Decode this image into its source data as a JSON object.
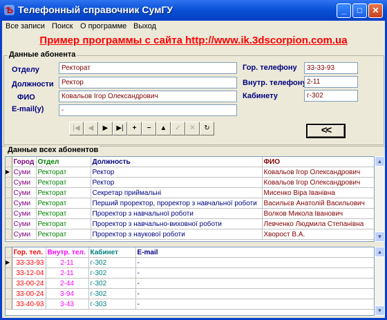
{
  "window": {
    "title": "Телефонный справочник СумГУ",
    "icon": "book-icon"
  },
  "title_buttons": {
    "minimize": "_",
    "maximize": "□",
    "close": "✕"
  },
  "menu": [
    "Все записи",
    "Поиск",
    "О программе",
    "Выход"
  ],
  "promo": "Пример программы с сайта http://www.ik.3dscorpion.com.ua",
  "subscriber": {
    "caption": "Данные абонента",
    "labels": {
      "dept": "Отделу",
      "position": "Должности",
      "fio": "ФИО",
      "email": "E-mail(y)",
      "city_phone": "Гор. телефону",
      "inner_phone": "Внутр. телефону",
      "room": "Кабинету"
    },
    "values": {
      "dept": "Ректорат",
      "position": "Ректор",
      "fio": "Ковальов Ігор Олександрович",
      "email": "-",
      "city_phone": "33-33-93",
      "inner_phone": "2-11",
      "room": "г-302"
    }
  },
  "navigator": [
    "|◀",
    "◀",
    "▶",
    "▶|",
    "+",
    "−",
    "▲",
    "✓",
    "✕",
    "↻"
  ],
  "back_button": "<<",
  "all_caption": "Данные всех абонентов",
  "table1": {
    "headers": [
      "Город",
      "Отдел",
      "Должность",
      "ФИО"
    ],
    "rows": [
      [
        "Суми",
        "Ректорат",
        "Ректор",
        "Ковальов Ігор Олександрович"
      ],
      [
        "Суми",
        "Ректорат",
        "Ректор",
        "Ковальов Ігор Олександрович"
      ],
      [
        "Суми",
        "Ректорат",
        "Секретар приймальні",
        "Мисенко Віра Іванівна"
      ],
      [
        "Суми",
        "Ректорат",
        "Перший проректор, проректор з навчальної роботи",
        "Васильєв Анатолій Васильович"
      ],
      [
        "Суми",
        "Ректорат",
        "Проректор з навчальної роботи",
        "Волков Микола Іванович"
      ],
      [
        "Суми",
        "Ректорат",
        "Проректор з навчально-виховної роботи",
        "Левченко Людмила Степанівна"
      ],
      [
        "Суми",
        "Ректорат",
        "Проректор з наукової роботи",
        "Хворост В.А."
      ]
    ]
  },
  "table2": {
    "headers": [
      "Гор. тел.",
      "Внутр. тел.",
      "Кабинет",
      "E-mail"
    ],
    "rows": [
      [
        "33-33-93",
        "2-11",
        "г-302",
        "-"
      ],
      [
        "33-12-04",
        "2-11",
        "г-302",
        "-"
      ],
      [
        "33-00-24",
        "2-44",
        "г-302",
        "-"
      ],
      [
        "33-00-24",
        "3-94",
        "г-302",
        "-"
      ],
      [
        "33-40-93",
        "3-43",
        "г-303",
        "-"
      ]
    ]
  },
  "current_row_marker": "▶"
}
